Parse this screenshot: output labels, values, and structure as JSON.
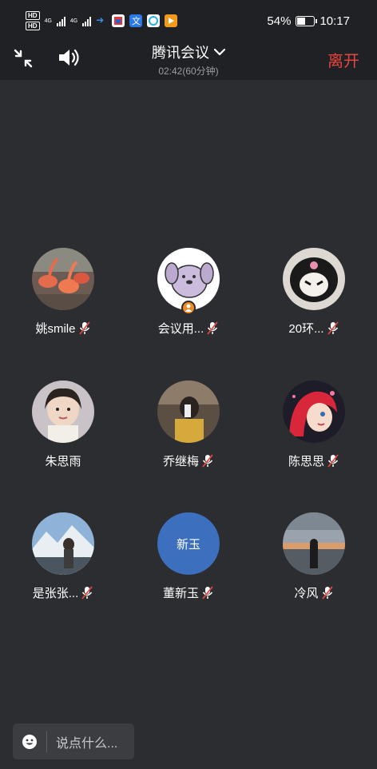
{
  "status_bar": {
    "network_labels": [
      "HD",
      "HD"
    ],
    "net_gen": [
      "4G",
      "4G"
    ],
    "battery": "54%",
    "battery_level": 0.54,
    "time": "10:17",
    "app_icons": [
      "arrow-icon",
      "tv-app-icon",
      "translate-app-icon",
      "chat-app-icon",
      "video-app-icon"
    ]
  },
  "header": {
    "title": "腾讯会议",
    "duration": "02:42(60分钟)",
    "leave_label": "离开",
    "leave_color": "#e7453f"
  },
  "participants": [
    {
      "name": "姚smile",
      "muted": true,
      "avatar": "flamingo-photo"
    },
    {
      "name": "会议用...",
      "muted": true,
      "avatar": "cartoon-dog",
      "host": true
    },
    {
      "name": "20环...",
      "muted": true,
      "avatar": "kuromi-plush"
    },
    {
      "name": "朱思雨",
      "muted": false,
      "avatar": "girl-photo"
    },
    {
      "name": "乔继梅",
      "muted": true,
      "avatar": "selfie-photo"
    },
    {
      "name": "陈思思",
      "muted": true,
      "avatar": "ariel-cartoon"
    },
    {
      "name": "是张张...",
      "muted": true,
      "avatar": "mountain-photo"
    },
    {
      "name": "董新玉",
      "muted": true,
      "avatar": "initials",
      "initials": "新玉",
      "avatar_color": "#3d6fbf"
    },
    {
      "name": "冷风",
      "muted": true,
      "avatar": "sunset-photo"
    }
  ],
  "chat": {
    "placeholder": "说点什么..."
  }
}
